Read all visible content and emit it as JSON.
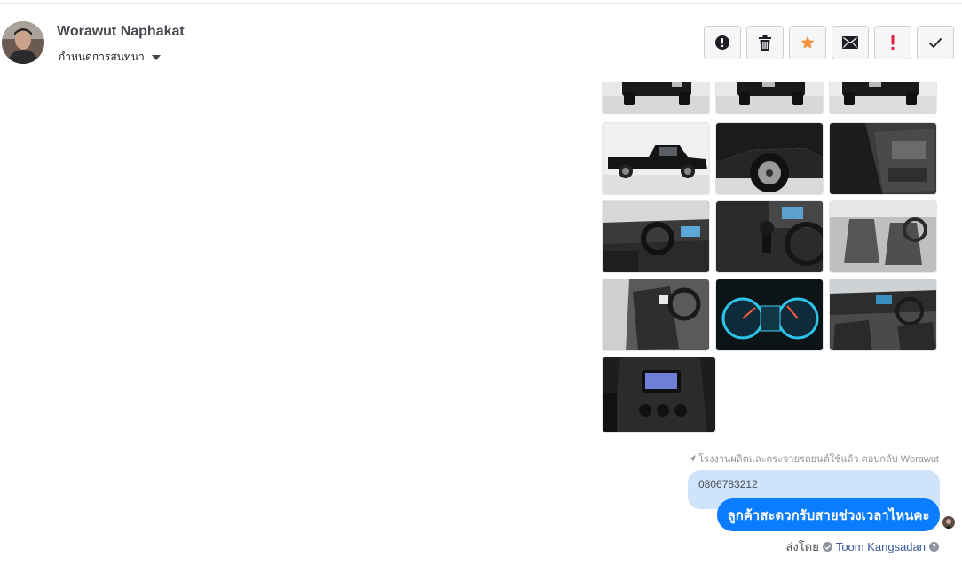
{
  "header": {
    "contact_name": "Worawut Naphakat",
    "assign_label": "กำหนดการสนทนา",
    "actions": [
      {
        "icon": "alert-circle-icon",
        "name": "mark-spam-button"
      },
      {
        "icon": "trash-icon",
        "name": "delete-button"
      },
      {
        "icon": "star-icon",
        "name": "star-button",
        "color": "#f7923b"
      },
      {
        "icon": "envelope-icon",
        "name": "mark-unread-button"
      },
      {
        "icon": "exclamation-icon",
        "name": "follow-up-button",
        "color": "#e41e3f"
      },
      {
        "icon": "check-icon",
        "name": "mark-done-button"
      }
    ]
  },
  "gallery": {
    "images": [
      {
        "subject": "truck-rear"
      },
      {
        "subject": "truck-rear"
      },
      {
        "subject": "truck-rear"
      },
      {
        "subject": "truck-side"
      },
      {
        "subject": "wheel-closeup"
      },
      {
        "subject": "door-open"
      },
      {
        "subject": "dashboard"
      },
      {
        "subject": "gear-shifter"
      },
      {
        "subject": "front-seats"
      },
      {
        "subject": "driver-seat"
      },
      {
        "subject": "gauge-cluster"
      },
      {
        "subject": "cabin-interior"
      },
      {
        "subject": "center-console"
      }
    ]
  },
  "conversation": {
    "reply_note": "โรงงานผลิตและกระจายรถยนต์ใช้แล้ว ตอบกลับ Worawut",
    "quoted_text": "0806783212",
    "message_text": "ลูกค้าสะดวกรับสายช่วงเวลาไหนคะ",
    "sent_by_label": "ส่งโดย",
    "agent_name": "Toom Kangsadan",
    "help_glyph": "?"
  },
  "colors": {
    "accent": "#0a7cff",
    "quoted_bubble": "#cfe3fb",
    "star": "#f7923b",
    "flag": "#e41e3f"
  }
}
